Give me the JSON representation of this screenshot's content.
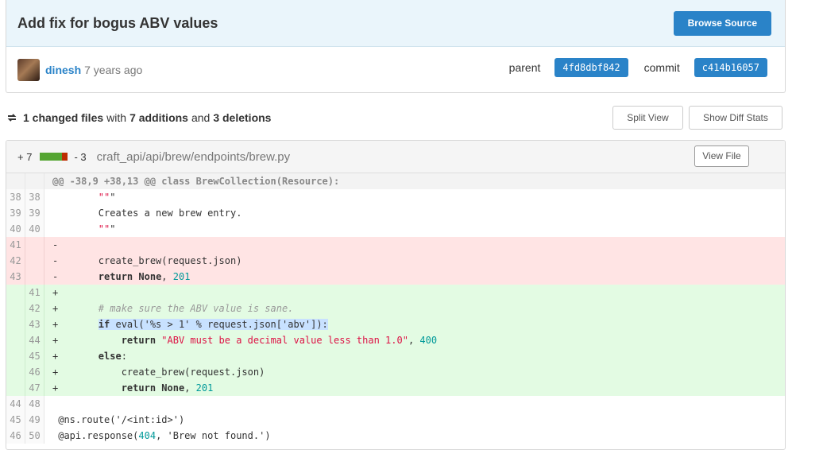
{
  "commit": {
    "title": "Add fix for bogus ABV values",
    "browse_label": "Browse Source",
    "author": "dinesh",
    "age": "7 years ago",
    "parent_label": "parent",
    "parent_sha": "4fd8dbf842",
    "commit_label": "commit",
    "commit_sha": "c414b16057"
  },
  "summary": {
    "changed_count": "1 changed files",
    "with": "with",
    "additions": "7 additions",
    "and": "and",
    "deletions": "3 deletions",
    "split_view_label": "Split View",
    "diff_stats_label": "Show Diff Stats"
  },
  "file": {
    "additions": "+ 7",
    "deletions": "- 3",
    "path": "craft_api/api/brew/endpoints/brew.py",
    "view_file_label": "View File",
    "colors": {
      "add": "#55a532",
      "del": "#bd2c00"
    }
  },
  "diff": {
    "hunk": "@@ -38,9 +38,13 @@ class BrewCollection(Resource):",
    "lines": [
      {
        "type": "ctx",
        "old": "38",
        "new": "38",
        "text": "        \"\"\""
      },
      {
        "type": "ctx",
        "old": "39",
        "new": "39",
        "text": "        Creates a new brew entry."
      },
      {
        "type": "ctx",
        "old": "40",
        "new": "40",
        "text": "        \"\"\""
      },
      {
        "type": "del",
        "old": "41",
        "new": "",
        "text": "-"
      },
      {
        "type": "del",
        "old": "42",
        "new": "",
        "text": "-       create_brew(request.json)"
      },
      {
        "type": "del",
        "old": "43",
        "new": "",
        "text": "-       return None, 201"
      },
      {
        "type": "add",
        "old": "",
        "new": "41",
        "text": "+"
      },
      {
        "type": "add",
        "old": "",
        "new": "42",
        "text": "+       # make sure the ABV value is sane."
      },
      {
        "type": "add",
        "old": "",
        "new": "43",
        "text": "+       if eval('%s > 1' % request.json['abv']):"
      },
      {
        "type": "add",
        "old": "",
        "new": "44",
        "text": "+           return \"ABV must be a decimal value less than 1.0\", 400"
      },
      {
        "type": "add",
        "old": "",
        "new": "45",
        "text": "+       else:"
      },
      {
        "type": "add",
        "old": "",
        "new": "46",
        "text": "+           create_brew(request.json)"
      },
      {
        "type": "add",
        "old": "",
        "new": "47",
        "text": "+           return None, 201"
      },
      {
        "type": "ctx",
        "old": "44",
        "new": "48",
        "text": ""
      },
      {
        "type": "ctx",
        "old": "45",
        "new": "49",
        "text": " @ns.route('/<int:id>')"
      },
      {
        "type": "ctx",
        "old": "46",
        "new": "50",
        "text": " @api.response(404, 'Brew not found.')"
      }
    ]
  }
}
